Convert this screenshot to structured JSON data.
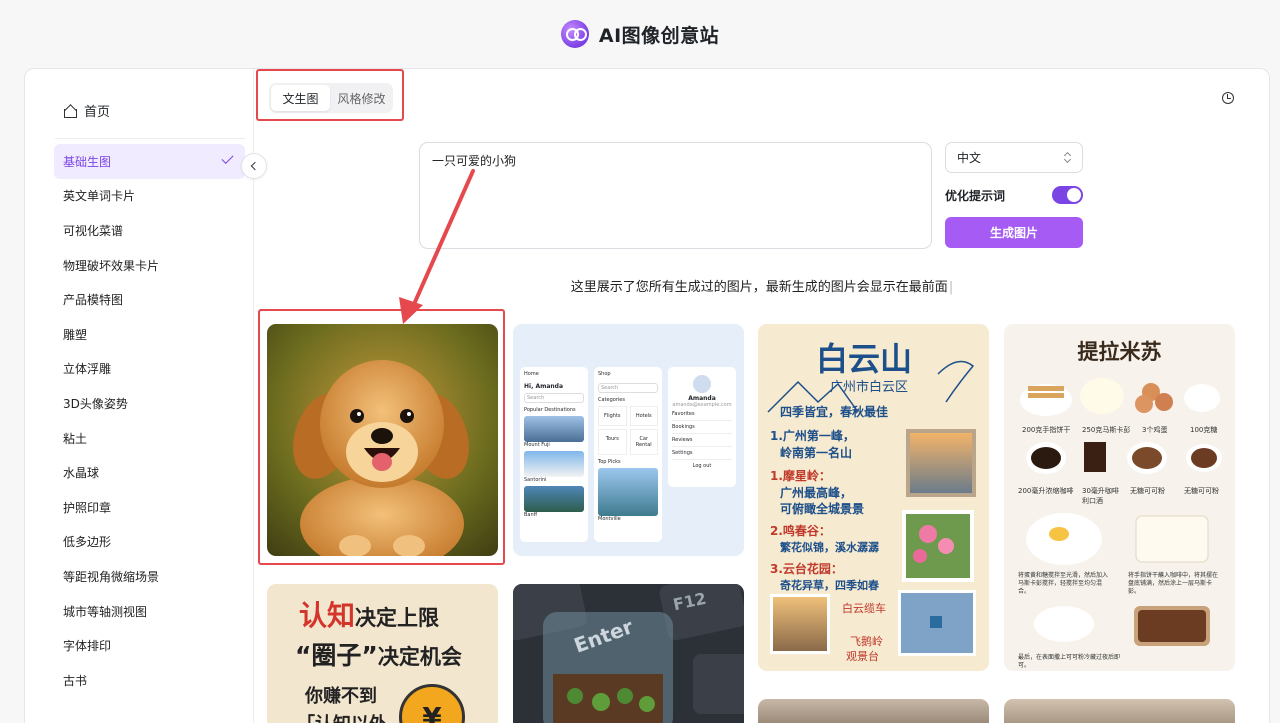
{
  "app": {
    "title": "AI图像创意站"
  },
  "sidebar": {
    "home_label": "首页",
    "items": [
      {
        "label": "基础生图",
        "active": true
      },
      {
        "label": "英文单词卡片"
      },
      {
        "label": "可视化菜谱"
      },
      {
        "label": "物理破坏效果卡片"
      },
      {
        "label": "产品模特图"
      },
      {
        "label": "雕塑"
      },
      {
        "label": "立体浮雕"
      },
      {
        "label": "3D头像姿势"
      },
      {
        "label": "粘土"
      },
      {
        "label": "水晶球"
      },
      {
        "label": "护照印章"
      },
      {
        "label": "低多边形"
      },
      {
        "label": "等距视角微缩场景"
      },
      {
        "label": "城市等轴测视图"
      },
      {
        "label": "字体排印"
      },
      {
        "label": "古书"
      }
    ]
  },
  "tabs": [
    {
      "label": "文生图",
      "active": true
    },
    {
      "label": "风格修改"
    }
  ],
  "prompt": {
    "value": "一只可爱的小狗"
  },
  "language": {
    "selected": "中文"
  },
  "optimize": {
    "label": "优化提示词",
    "enabled": true
  },
  "generate_button": "生成图片",
  "info_text": "这里展示了您所有生成过的图片，最新生成的图片会显示在最前面",
  "gallery": {
    "app_mock": {
      "col1_title": "Home",
      "greeting": "Hi, Amanda",
      "search": "Search",
      "section": "Popular Destinations",
      "place1": "Mount Fuji",
      "place2": "Santorini",
      "place3": "Banff",
      "col2_title": "Shop",
      "categories": "Categories",
      "cat1": "Flights",
      "cat2": "Hotels",
      "cat3": "Tours",
      "cat4": "Car Rental",
      "top_picks": "Top Picks",
      "pick1": "Montville",
      "profile_name": "Amanda",
      "profile_email": "amanda@example.com",
      "menu1": "Favorites",
      "menu2": "Bookings",
      "menu3": "Reviews",
      "menu4": "Settings",
      "logout": "Log out"
    },
    "baiyun": {
      "title": "白云山",
      "subtitle": "广州市白云区",
      "slogan": "四季皆宜，春秋最佳",
      "p1a": "1.广州第一峰，",
      "p1b": "岭南第一名山",
      "p2a": "1.摩星岭：",
      "p2b": "广州最高峰，",
      "p2c": "可俯瞰全城景景",
      "p3a": "2.鸣春谷：",
      "p3b": "繁花似锦，溪水潺潺",
      "p4a": "3.云台花园：",
      "p4b": "奇花异草，四季如春",
      "tag1": "白云缆车",
      "tag2": "飞鹅岭",
      "tag3": "观景台"
    },
    "tiramisu": {
      "title": "提拉米苏",
      "i1": "200克手指饼干",
      "i2": "250克马斯卡彭",
      "i3": "3个鸡蛋",
      "i4": "100克糖",
      "i5": "200毫升浓缩咖啡",
      "i6": "30毫升咖啡利口酒",
      "i7": "无糖可可粉",
      "i8": "无糖可可粉",
      "s1": "将蛋黄和糖搅拌至光滑，然后加入马斯卡彭搅拌，轻搅拌至均匀混合。",
      "s2": "将手指饼干蘸入咖啡中，将其摆在盘底铺满，然后涂上一层马斯卡彭。",
      "s3": "最后，在表面撒上可可粉冷藏过夜后即可。"
    },
    "poster": {
      "line1a": "认知",
      "line1b": "决定上限",
      "line2a": "“圈子”",
      "line2b": "决定机会",
      "line3": "你赚不到",
      "line4": "「认知以外",
      "coin": "¥"
    },
    "keyboard": {
      "key1": "Enter",
      "key2": "F12"
    }
  },
  "colors": {
    "accent": "#7b45e6",
    "button": "#a65cf4",
    "annotation": "#e5484d"
  }
}
